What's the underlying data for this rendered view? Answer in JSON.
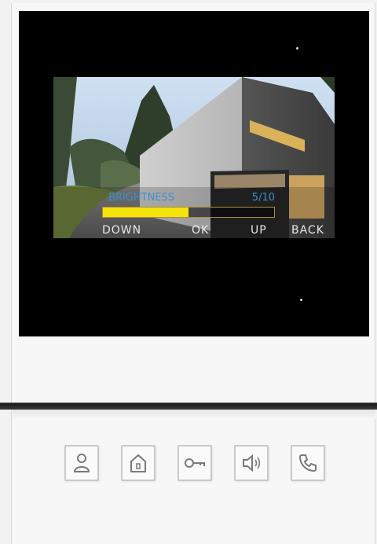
{
  "osd": {
    "label": "BRIGHTNESS",
    "value_text": "5/10",
    "level": 5,
    "max": 10,
    "buttons": {
      "down": "DOWN",
      "ok": "OK",
      "up": "UP",
      "back": "BACK"
    },
    "label_color": "#3d8fcc",
    "fill_color": "#f4e40a"
  },
  "hardware_keys": [
    {
      "icon": "person-icon"
    },
    {
      "icon": "home-icon"
    },
    {
      "icon": "key-icon"
    },
    {
      "icon": "speaker-icon"
    },
    {
      "icon": "phone-icon"
    }
  ]
}
